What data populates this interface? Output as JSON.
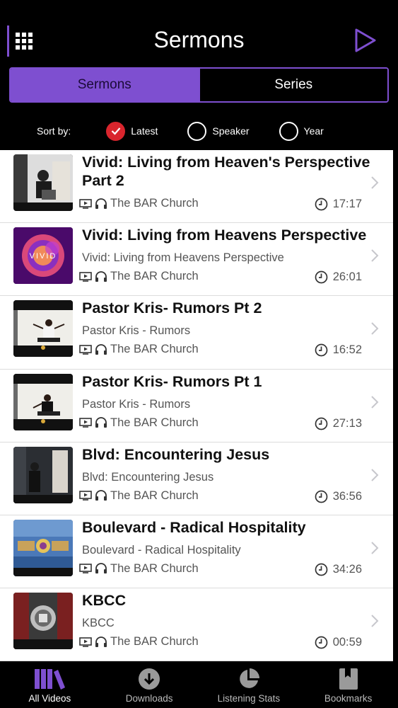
{
  "header": {
    "title": "Sermons"
  },
  "segments": {
    "sermons": "Sermons",
    "series": "Series"
  },
  "sort": {
    "label": "Sort by:",
    "options": [
      "Latest",
      "Speaker",
      "Year"
    ],
    "selected": "Latest"
  },
  "colors": {
    "accent": "#7e4fd0",
    "selected_radio": "#d9252d"
  },
  "sermons": [
    {
      "title": "Vivid: Living from Heaven's Perspective Part 2",
      "subtitle": "",
      "church": "The BAR Church",
      "duration": "17:17"
    },
    {
      "title": "Vivid: Living from Heavens Perspective",
      "subtitle": "Vivid: Living from Heavens Perspective",
      "church": "The BAR Church",
      "duration": "26:01"
    },
    {
      "title": "Pastor Kris- Rumors Pt 2",
      "subtitle": "Pastor Kris - Rumors",
      "church": "The BAR Church",
      "duration": "16:52"
    },
    {
      "title": "Pastor Kris- Rumors Pt 1",
      "subtitle": "Pastor Kris - Rumors",
      "church": "The BAR Church",
      "duration": "27:13"
    },
    {
      "title": "Blvd: Encountering Jesus",
      "subtitle": "Blvd: Encountering Jesus",
      "church": "The BAR Church",
      "duration": "36:56"
    },
    {
      "title": "Boulevard - Radical Hospitality",
      "subtitle": "Boulevard - Radical Hospitality",
      "church": "The BAR Church",
      "duration": "34:26"
    },
    {
      "title": "KBCC",
      "subtitle": "KBCC",
      "church": "The BAR Church",
      "duration": "00:59"
    }
  ],
  "thumb_text": {
    "vivid": "VIVID"
  },
  "tabbar": {
    "all_videos": "All Videos",
    "downloads": "Downloads",
    "listening_stats": "Listening Stats",
    "bookmarks": "Bookmarks"
  },
  "icons": [
    "grid-icon",
    "play-icon",
    "check-icon",
    "video-icon",
    "headphones-icon",
    "clock-icon",
    "chevron-right-icon",
    "library-icon",
    "download-icon",
    "pie-chart-icon",
    "bookmark-icon"
  ]
}
